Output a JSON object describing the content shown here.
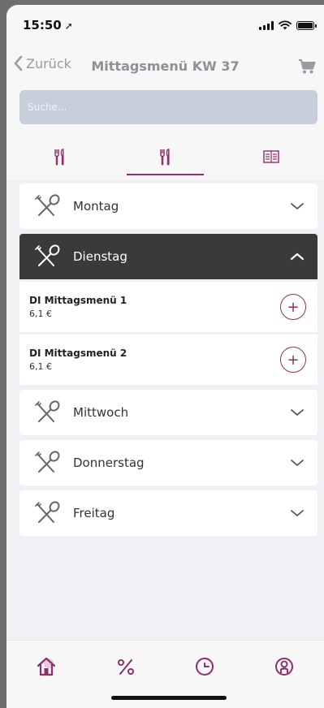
{
  "status": {
    "time": "15:50"
  },
  "nav": {
    "back_label": "Zurück",
    "title": "Mittagsmenü KW 37"
  },
  "search": {
    "placeholder": "Suche..."
  },
  "tabs": [
    {
      "icon": "cutlery-icon",
      "active": false
    },
    {
      "icon": "cutlery-icon",
      "active": true
    },
    {
      "icon": "menu-card-icon",
      "active": false
    }
  ],
  "days": [
    {
      "label": "Montag",
      "open": false
    },
    {
      "label": "Dienstag",
      "open": true,
      "dishes": [
        {
          "name": "DI Mittagsmenü 1",
          "price": "6,1 €"
        },
        {
          "name": "DI Mittagsmenü 2",
          "price": "6,1 €"
        }
      ]
    },
    {
      "label": "Mittwoch",
      "open": false
    },
    {
      "label": "Donnerstag",
      "open": false
    },
    {
      "label": "Freitag",
      "open": false
    }
  ],
  "bottom_nav": [
    {
      "icon": "home-icon",
      "active": true
    },
    {
      "icon": "percent-icon",
      "active": false
    },
    {
      "icon": "clock-icon",
      "active": false
    },
    {
      "icon": "profile-icon",
      "active": false
    }
  ],
  "colors": {
    "accent": "#8e2f6a",
    "open_header": "#3a3a3a"
  }
}
